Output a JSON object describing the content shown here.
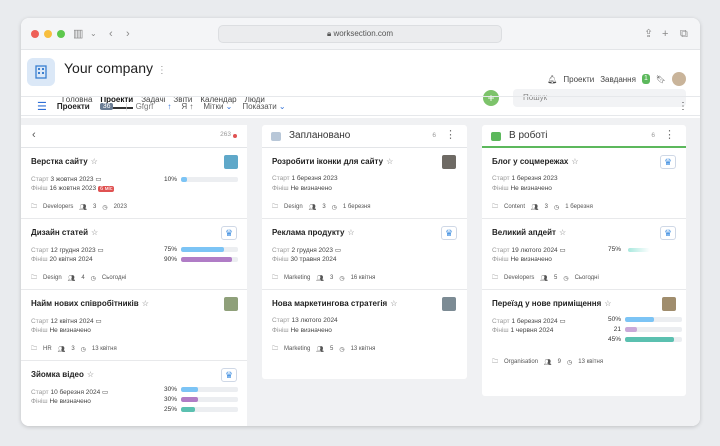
{
  "browser": {
    "url": "worksection.com"
  },
  "header": {
    "company": "Your company",
    "nav": [
      "Головна",
      "Проекти",
      "Задачі",
      "Звіти",
      "Календар",
      "Люди"
    ],
    "active_nav": "Проекти",
    "right": {
      "projects": "Проекти",
      "tasks": "Завдання",
      "tasks_badge": "1"
    },
    "search_placeholder": "Пошук"
  },
  "toolbar": {
    "title": "Проекти",
    "count": "36",
    "filter": "Gfgrf",
    "sort_a": "↑",
    "sort_ya": "Я ↑",
    "tags": "Мітки",
    "show": "Показати"
  },
  "col1": {
    "count": "263",
    "cards": [
      {
        "title": "Верстка сайту",
        "start_label": "Старт",
        "start": "3 жовтня 2023",
        "finish_label": "Фініш",
        "finish": "16 жовтня 2023",
        "overdue": "6 міс",
        "bars": [
          {
            "label": "10%",
            "value": 0.1,
            "color": "#7cc4f5"
          }
        ],
        "foot": {
          "tag": "Developers",
          "people": "3",
          "date": "2023"
        }
      },
      {
        "title": "Дизайн статей",
        "start_label": "Старт",
        "start": "12 грудня 2023",
        "finish_label": "Фініш",
        "finish": "20 квітня 2024",
        "bars": [
          {
            "label": "75%",
            "value": 0.75,
            "color": "#7cc4f5"
          },
          {
            "label": "90%",
            "value": 0.9,
            "color": "#b07cc6"
          }
        ],
        "foot": {
          "tag": "Design",
          "people": "4",
          "date": "Сьогодні"
        }
      },
      {
        "title": "Найм нових співробітників",
        "start_label": "Старт",
        "start": "12 квітня 2024",
        "finish_label": "Фініш",
        "finish": "Не визначено",
        "bars": [],
        "foot": {
          "tag": "HR",
          "people": "3",
          "date": "13 квітня"
        }
      },
      {
        "title": "Зйомка відео",
        "start_label": "Старт",
        "start": "10 березня 2024",
        "finish_label": "Фініш",
        "finish": "Не визначено",
        "bars": [
          {
            "label": "30%",
            "value": 0.3,
            "color": "#7cc4f5"
          },
          {
            "label": "30%",
            "value": 0.3,
            "color": "#b07cc6"
          },
          {
            "label": "25%",
            "value": 0.25,
            "color": "#5bc0b0"
          }
        ],
        "foot": {
          "tag": "",
          "people": "",
          "date": ""
        }
      }
    ]
  },
  "col2": {
    "title": "Заплановано",
    "count": "6",
    "color": "#b8c7d8",
    "cards": [
      {
        "title": "Розробити іконки для сайту",
        "start_label": "Старт",
        "start": "1 березня 2023",
        "finish_label": "Фініш",
        "finish": "Не визначено",
        "foot": {
          "tag": "Design",
          "people": "3",
          "date": "1 березня"
        }
      },
      {
        "title": "Реклама продукту",
        "start_label": "Старт",
        "start": "2 грудня 2023",
        "finish_label": "Фініш",
        "finish": "30 травня 2024",
        "foot": {
          "tag": "Marketing",
          "people": "3",
          "date": "16 квітня"
        }
      },
      {
        "title": "Нова маркетингова стратегія",
        "start_label": "Старт",
        "start": "13 лютого 2024",
        "finish_label": "Фініш",
        "finish": "Не визначено",
        "foot": {
          "tag": "Marketing",
          "people": "5",
          "date": "13 квітня"
        }
      }
    ]
  },
  "col3": {
    "title": "В роботі",
    "count": "6",
    "color": "#5cb85c",
    "cards": [
      {
        "title": "Блог у соцмережах",
        "start_label": "Старт",
        "start": "1 березня 2023",
        "finish_label": "Фініш",
        "finish": "Не визначено",
        "bars": [],
        "foot": {
          "tag": "Content",
          "people": "3",
          "date": "1 березня"
        }
      },
      {
        "title": "Великий апдейт",
        "start_label": "Старт",
        "start": "19 лютого 2024",
        "finish_label": "Фініш",
        "finish": "Не визначено",
        "bars": [
          {
            "label": "75%",
            "value": 0.75,
            "color": "#a8e8de"
          }
        ],
        "foot": {
          "tag": "Developers",
          "people": "5",
          "date": "Сьогодні"
        }
      },
      {
        "title": "Переїзд у нове приміщення",
        "start_label": "Старт",
        "start": "1 березня 2024",
        "finish_label": "Фініш",
        "finish": "1 червня 2024",
        "bars": [
          {
            "label": "50%",
            "value": 0.5,
            "color": "#7cc4f5"
          },
          {
            "label": "21",
            "value": 0.21,
            "color": "#c9a9d9"
          },
          {
            "label": "45%",
            "value": 0.85,
            "color": "#5bc0b0"
          }
        ],
        "foot": {
          "tag": "Organisation",
          "people": "9",
          "date": "13 квітня"
        }
      }
    ]
  }
}
